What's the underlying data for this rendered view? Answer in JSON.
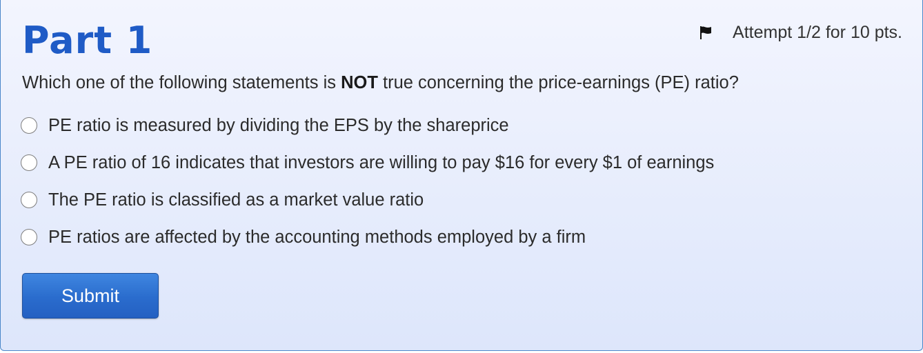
{
  "part": {
    "title": "Part 1"
  },
  "attempt": {
    "icon": "flag-icon",
    "text": "Attempt 1/2 for 10 pts."
  },
  "question": {
    "prefix": "Which one of the following statements is ",
    "emphasis": "NOT",
    "suffix": " true concerning the price-earnings (PE) ratio?"
  },
  "options": [
    {
      "label": "PE ratio is measured by dividing the EPS by the shareprice",
      "selected": false
    },
    {
      "label": "A PE ratio of 16 indicates that investors are willing to pay $16 for every $1 of earnings",
      "selected": false
    },
    {
      "label": "The PE ratio is classified as a market value ratio",
      "selected": false
    },
    {
      "label": "PE ratios are affected by the accounting methods employed by a firm",
      "selected": false
    }
  ],
  "submit": {
    "label": "Submit"
  },
  "colors": {
    "title": "#1f5bc6",
    "card_border": "#4a86c9",
    "background_top": "#f3f5fe",
    "background_bottom": "#dde6fb",
    "button": "#2a6ccd"
  }
}
